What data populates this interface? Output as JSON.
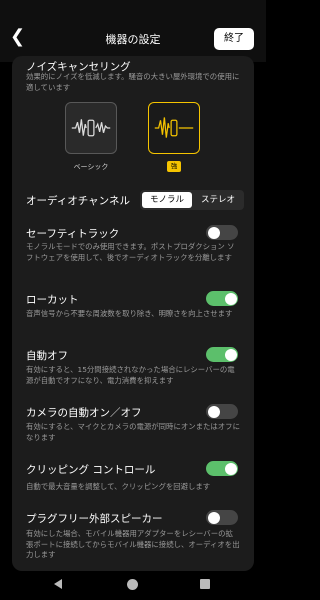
{
  "header": {
    "back_icon": "chevron-left-icon",
    "title": "機器の設定",
    "done_label": "終了"
  },
  "noise_cancel": {
    "title": "ノイズキャンセリング",
    "desc": "効果的にノイズを低減します。騒音の大きい屋外環境での使用に適しています",
    "modes": [
      {
        "label": "ベーシック",
        "selected": false
      },
      {
        "label": "強",
        "selected": true
      }
    ],
    "accent": "#f5c400"
  },
  "audio_channel": {
    "title": "オーディオチャンネル",
    "options": [
      "モノラル",
      "ステレオ"
    ],
    "selected": "モノラル"
  },
  "settings": [
    {
      "title": "セーフティトラック",
      "desc": "モノラルモードでのみ使用できます。ポストプロダクション ソフトウェアを使用して、後でオーディオトラックを分離します",
      "on": false
    },
    {
      "title": "ローカット",
      "desc": "音声信号から不要な周波数を取り除き、明瞭さを向上させます",
      "on": true
    },
    {
      "title": "自動オフ",
      "desc": "有効にすると、15分間接続されなかった場合にレシーバーの電源が自動でオフになり、電力消費を抑えます",
      "on": true
    },
    {
      "title": "カメラの自動オン／オフ",
      "desc": "有効にすると、マイクとカメラの電源が同時にオンまたはオフになります",
      "on": false
    },
    {
      "title": "クリッピング コントロール",
      "desc": "自動で最大音量を調整して、クリッピングを回避します",
      "on": true
    },
    {
      "title": "プラグフリー外部スピーカー",
      "desc": "有効にした場合、モバイル機器用アダプターをレシーバーの拡張ポートに接続してからモバイル機器に接続し、オーディオを出力します",
      "on": false
    }
  ],
  "colors": {
    "toggle_on": "#5cbf6b",
    "toggle_off": "#454545",
    "card_bg": "#1c1c1c"
  },
  "nav": {
    "back_icon": "triangle-back-icon",
    "home_icon": "circle-home-icon",
    "recent_icon": "square-recents-icon"
  }
}
